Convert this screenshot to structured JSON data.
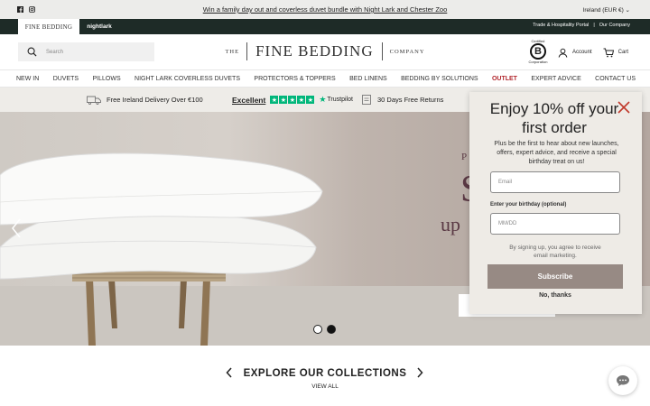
{
  "topbar": {
    "promo": "Win a family day out and coverless duvet bundle with Night Lark and Chester Zoo",
    "locale": "Ireland (EUR €)",
    "locale_chevron": "⌄"
  },
  "brandbar": {
    "tab_fine": "FINE BEDDING",
    "tab_nightlark": "nightlark",
    "trade_link": "Trade & Hospitality Portal",
    "separator": "|",
    "company_link": "Our Company"
  },
  "header": {
    "search_placeholder": "Search",
    "logo_the": "THE",
    "logo_main": "FINE BEDDING",
    "logo_company": "COMPANY",
    "bcorp_top": "Certified",
    "bcorp_letter": "B",
    "bcorp_bottom": "Corporation",
    "account": "Account",
    "cart": "Cart"
  },
  "nav": {
    "items": [
      "NEW IN",
      "DUVETS",
      "PILLOWS",
      "NIGHT LARK COVERLESS DUVETS",
      "PROTECTORS & TOPPERS",
      "BED LINENS",
      "BEDDING BY SOLUTIONS",
      "OUTLET",
      "EXPERT ADVICE",
      "CONTACT US"
    ]
  },
  "usp": {
    "delivery": "Free Ireland Delivery Over €100",
    "rating": "Excellent",
    "trustpilot": "Trustpilot",
    "returns": "30 Days Free Returns"
  },
  "hero": {
    "heading_partial": "P",
    "big_partial": "S",
    "sub_partial": "up"
  },
  "collections": {
    "title": "EXPLORE OUR COLLECTIONS",
    "view_all": "VIEW ALL"
  },
  "popup": {
    "title": "Enjoy 10% off your first order",
    "description": "Plus be the first to hear about new launches, offers, expert advice, and receive a special birthday treat on us!",
    "email_placeholder": "Email",
    "birthday_label": "Enter your birthday (optional)",
    "birthday_placeholder": "MM/DD",
    "consent": "By signing up, you agree to receive email marketing.",
    "subscribe": "Subscribe",
    "no_thanks": "No, thanks"
  },
  "icons": [
    "facebook-icon",
    "instagram-icon",
    "search-icon",
    "account-icon",
    "cart-icon",
    "van-icon",
    "returns-icon",
    "chevron-left-icon",
    "chevron-right-icon",
    "close-icon",
    "chat-icon"
  ],
  "colors": {
    "accent_outlet": "#b2282e",
    "brand_dark": "#1e2b27",
    "trustpilot": "#00b67a",
    "subscribe": "#978a84",
    "close": "#c0392b"
  }
}
